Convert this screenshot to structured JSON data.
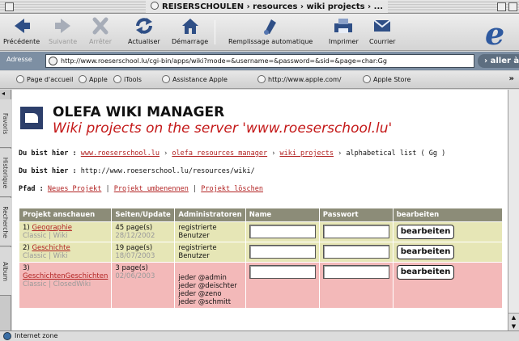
{
  "window": {
    "title": "REISERSCHOULEN › resources › wiki projects › ..."
  },
  "toolbar": {
    "buttons": [
      {
        "label": "Précédente",
        "icon": "back-arrow-icon",
        "enabled": true
      },
      {
        "label": "Suivante",
        "icon": "forward-arrow-icon",
        "enabled": false
      },
      {
        "label": "Arrêter",
        "icon": "stop-x-icon",
        "enabled": false
      },
      {
        "label": "Actualiser",
        "icon": "refresh-icon",
        "enabled": true
      },
      {
        "label": "Démarrage",
        "icon": "home-icon",
        "enabled": true
      },
      {
        "label": "Remplissage automatique",
        "icon": "autofill-icon",
        "enabled": true
      },
      {
        "label": "Imprimer",
        "icon": "printer-icon",
        "enabled": true
      },
      {
        "label": "Courrier",
        "icon": "mail-icon",
        "enabled": true
      }
    ]
  },
  "address": {
    "label": "Adresse",
    "url": "http://www.roeserschool.lu/cgi-bin/apps/wiki?mode=&username=&password=&sid=&page=char:Gg",
    "go_label": "› aller à"
  },
  "favorites": {
    "items": [
      "Page d'accueil",
      "Apple",
      "iTools",
      "Assistance Apple",
      "http://www.apple.com/",
      "Apple Store"
    ],
    "more": "»"
  },
  "sidetabs": [
    "Favoris",
    "Historique",
    "Recherche",
    "Album"
  ],
  "page": {
    "title": "OLEFA WIKI MANAGER",
    "subtitle": "Wiki projects on the server 'www.roeserschool.lu'",
    "breadcrumb_label": "Du bist hier :",
    "breadcrumb": [
      {
        "text": "www.roeserschool.lu",
        "link": true
      },
      {
        "text": "olefa resources manager",
        "link": true
      },
      {
        "text": "wiki projects",
        "link": true
      },
      {
        "text": "alphabetical list ( Gg )",
        "link": false
      }
    ],
    "path_label": "Du bist hier :",
    "path_value": "http://www.roeserschool.lu/resources/wiki/",
    "pfad_label": "Pfad :",
    "pfad_links": [
      "Neues Projekt",
      "Projekt umbenennen",
      "Projekt löschen"
    ]
  },
  "table": {
    "headers": [
      "Projekt anschauen",
      "Seiten/Update",
      "Administratoren",
      "Name",
      "Passwort",
      "bearbeiten"
    ],
    "rows": [
      {
        "num": "1)",
        "project": "Geographie",
        "sub": "Classic | Wiki",
        "pages": "45 page(s)",
        "date": "28/12/2002",
        "admins": [
          "registrierte",
          "Benutzer"
        ],
        "button": "bearbeiten",
        "status": "ok"
      },
      {
        "num": "2)",
        "project": "Geschichte",
        "sub": "Classic | Wiki",
        "pages": "19 page(s)",
        "date": "18/07/2003",
        "admins": [
          "registrierte",
          "Benutzer"
        ],
        "button": "bearbeiten",
        "status": "ok"
      },
      {
        "num": "3)",
        "project": "GeschichtenGeschichten",
        "sub": "Classic | ClosedWiki",
        "pages": "3 page(s)",
        "date": "02/06/2003",
        "admins": [
          "jeder @admin",
          "jeder @deischter",
          "jeder @zeno",
          "jeder @schmitt"
        ],
        "button": "bearbeiten",
        "status": "closed"
      }
    ]
  },
  "status": {
    "text": "Internet zone"
  },
  "colors": {
    "row_ok": "#e6e6b6",
    "row_closed": "#f3b9b9",
    "header": "#8c8c78",
    "link": "#b22222",
    "subtitle": "#c41919"
  }
}
